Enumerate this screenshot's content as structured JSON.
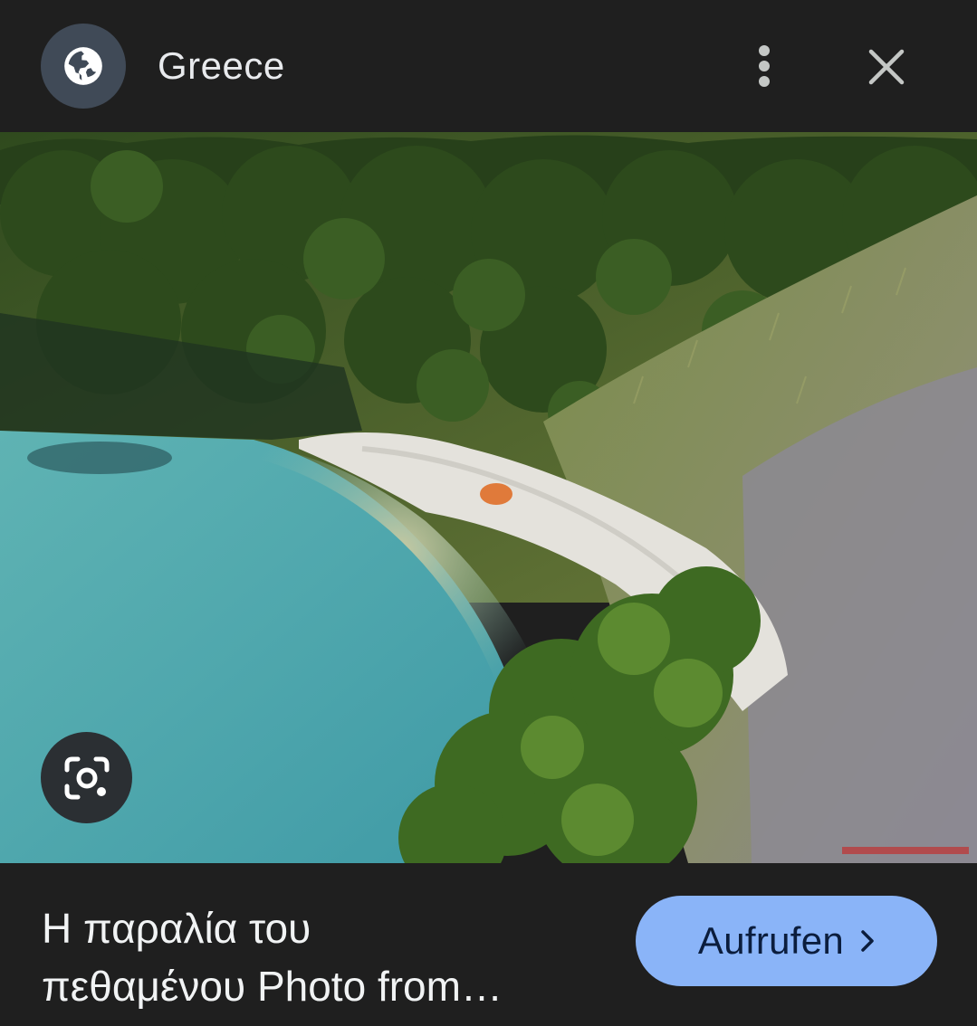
{
  "header": {
    "site_name": "Greece",
    "site_icon": "globe-icon",
    "more_icon": "more-vert-icon",
    "close_icon": "close-icon"
  },
  "image": {
    "lens_icon": "google-lens-icon"
  },
  "footer": {
    "caption_line1": "Η παραλία του",
    "caption_line2": "πεθαμένου Photo from…",
    "open_button_label": "Aufrufen",
    "open_button_icon": "chevron-right-icon"
  },
  "colors": {
    "background": "#1f1f1f",
    "accent_button": "#8ab4f8",
    "icon_circle": "#404a57",
    "text": "#e8eaed"
  }
}
